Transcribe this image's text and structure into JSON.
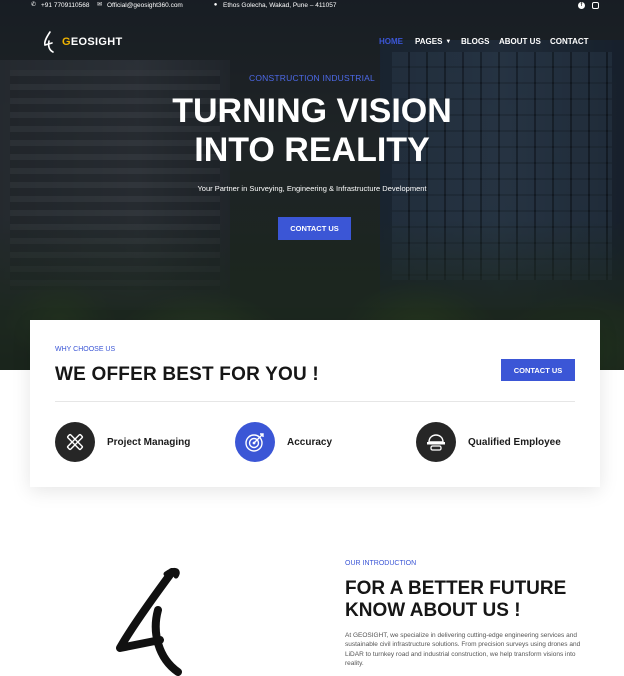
{
  "topbar": {
    "phone": "+91 7709110568",
    "email": "Official@geosight360.com",
    "address": "Ethos Golecha, Wakad, Pune – 411057"
  },
  "brand": {
    "name_first": "G",
    "name_rest": "EOSIGHT"
  },
  "nav": {
    "home": "HOME",
    "pages": "PAGES",
    "blogs": "BLOGS",
    "about": "ABOUT US",
    "contact": "CONTACT"
  },
  "hero": {
    "kicker": "CONSTRUCTION INDUSTRIAL",
    "headline_line1": "TURNING VISION",
    "headline_line2": "INTO REALITY",
    "subline": "Your Partner in Surveying, Engineering & Infrastructure Development",
    "cta": "CONTACT US"
  },
  "why": {
    "sub": "WHY CHOOSE US",
    "title": "WE OFFER BEST FOR YOU !",
    "cta": "CONTACT US",
    "features": [
      {
        "label": "Project Managing",
        "icon": "tools-icon"
      },
      {
        "label": "Accuracy",
        "icon": "target-icon"
      },
      {
        "label": "Qualified Employee",
        "icon": "hard-hat-icon"
      }
    ]
  },
  "intro": {
    "sub": "OUR INTRODUCTION",
    "title_line1": "FOR A BETTER FUTURE",
    "title_line2": "KNOW ABOUT US !",
    "body": "At GEOSIGHT, we specialize in delivering cutting-edge engineering services and sustainable civil infrastructure solutions. From precision surveys using drones and LiDAR to turnkey road and industrial construction, we help transform visions into reality."
  },
  "colors": {
    "accent": "#3b56d6",
    "brand_gold": "#f0b400",
    "dark": "#262626"
  }
}
